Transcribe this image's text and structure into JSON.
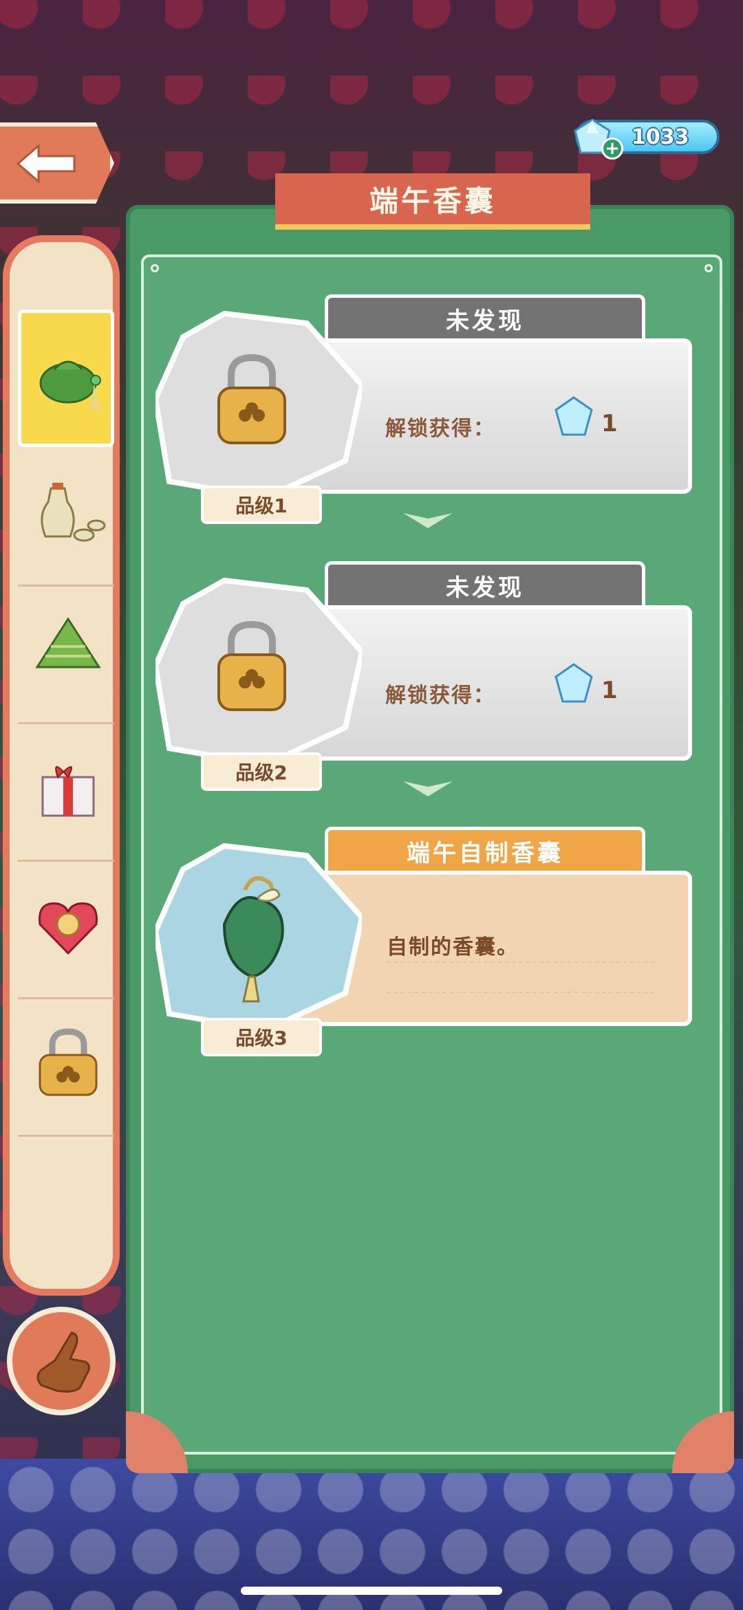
{
  "header": {
    "back_icon": "back-arrow-icon",
    "currency": {
      "icon": "diamond-icon",
      "add_icon": "plus-icon",
      "amount": "1033"
    }
  },
  "panel": {
    "title": "端午香囊"
  },
  "sidebar": {
    "items": [
      {
        "icon": "sachet-icon",
        "selected": true
      },
      {
        "icon": "wine-jug-icon",
        "selected": false
      },
      {
        "icon": "zongzi-icon",
        "selected": false
      },
      {
        "icon": "gift-box-icon",
        "selected": false
      },
      {
        "icon": "ring-box-icon",
        "selected": false
      },
      {
        "icon": "locked-icon",
        "selected": false
      }
    ],
    "hand_icon": "pointing-hand-icon"
  },
  "cards": [
    {
      "status": "未发现",
      "reward_label": "解锁获得：",
      "reward_icon": "diamond-icon",
      "reward_count": "1",
      "grade": "品级1"
    },
    {
      "status": "未发现",
      "reward_label": "解锁获得：",
      "reward_icon": "diamond-icon",
      "reward_count": "1",
      "grade": "品级2"
    },
    {
      "status": "端午自制香囊",
      "description": "自制的香囊。",
      "item_icon": "sachet-icon",
      "grade": "品级3"
    }
  ],
  "colors": {
    "panel_green": "#4a9a68",
    "accent_orange": "#e07a58",
    "ribbon_red": "#d8664f",
    "sidebar_cream": "#f3e3c6",
    "selected_yellow": "#f9d94c",
    "locked_gray": "#737373",
    "found_orange": "#f0a646"
  }
}
